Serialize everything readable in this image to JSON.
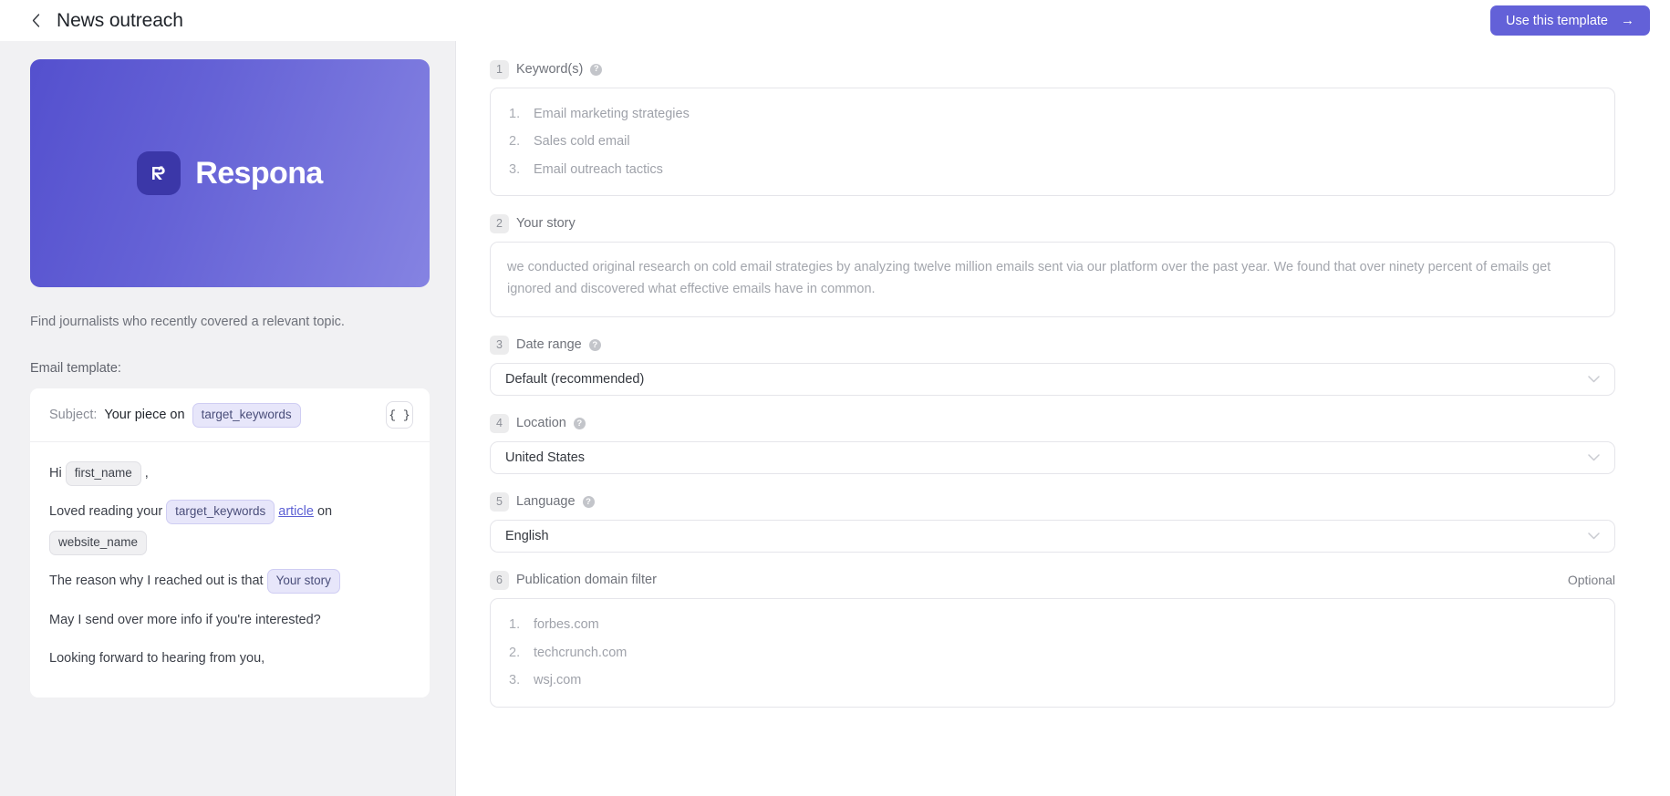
{
  "header": {
    "back_icon": "chevron-left-icon",
    "title": "News outreach",
    "use_template_label": "Use this template",
    "use_template_arrow": "→",
    "accent_color": "#6361d8"
  },
  "left_pane": {
    "hero": {
      "brand": "Respona",
      "logo_mark": "R",
      "gradient_from": "#5450ce",
      "gradient_to": "#8583e2"
    },
    "description": "Find journalists who recently covered a relevant topic.",
    "email_template_label": "Email template:",
    "email": {
      "subject_label": "Subject:",
      "subject_text": "Your piece on",
      "subject_chip": "target_keywords",
      "variables_button": "{ }",
      "lines": [
        {
          "parts": [
            {
              "type": "text",
              "value": "Hi "
            },
            {
              "type": "chip-gray",
              "value": "first_name"
            },
            {
              "type": "text",
              "value": ","
            }
          ]
        },
        {
          "parts": [
            {
              "type": "text",
              "value": "Loved reading your "
            },
            {
              "type": "chip-purple",
              "value": "target_keywords"
            },
            {
              "type": "link",
              "value": "article"
            },
            {
              "type": "text",
              "value": " on "
            },
            {
              "type": "chip-gray",
              "value": "website_name"
            }
          ]
        },
        {
          "parts": [
            {
              "type": "text",
              "value": "The reason why I reached out is that "
            },
            {
              "type": "chip-purple",
              "value": "Your story"
            }
          ]
        },
        {
          "parts": [
            {
              "type": "text",
              "value": "May I send over more info if you're interested?"
            }
          ]
        },
        {
          "parts": [
            {
              "type": "text",
              "value": "Looking forward to hearing from you,"
            }
          ]
        }
      ]
    }
  },
  "right_pane": {
    "sections": [
      {
        "num": "1",
        "label": "Keyword(s)",
        "info": true,
        "optional": "",
        "type": "list",
        "items": [
          "Email marketing strategies",
          "Sales cold email",
          "Email outreach tactics"
        ]
      },
      {
        "num": "2",
        "label": "Your story",
        "info": false,
        "optional": "",
        "type": "textarea",
        "text": "we conducted original research on cold email strategies by analyzing twelve million emails sent via our platform over the past year. We found that over ninety percent of emails get ignored and discovered what effective emails have in common."
      },
      {
        "num": "3",
        "label": "Date range",
        "info": true,
        "optional": "",
        "type": "select",
        "value": "Default (recommended)"
      },
      {
        "num": "4",
        "label": "Location",
        "info": true,
        "optional": "",
        "type": "select",
        "value": "United States"
      },
      {
        "num": "5",
        "label": "Language",
        "info": true,
        "optional": "",
        "type": "select",
        "value": "English"
      },
      {
        "num": "6",
        "label": "Publication domain filter",
        "info": false,
        "optional": "Optional",
        "type": "list",
        "items": [
          "forbes.com",
          "techcrunch.com",
          "wsj.com"
        ]
      }
    ]
  }
}
